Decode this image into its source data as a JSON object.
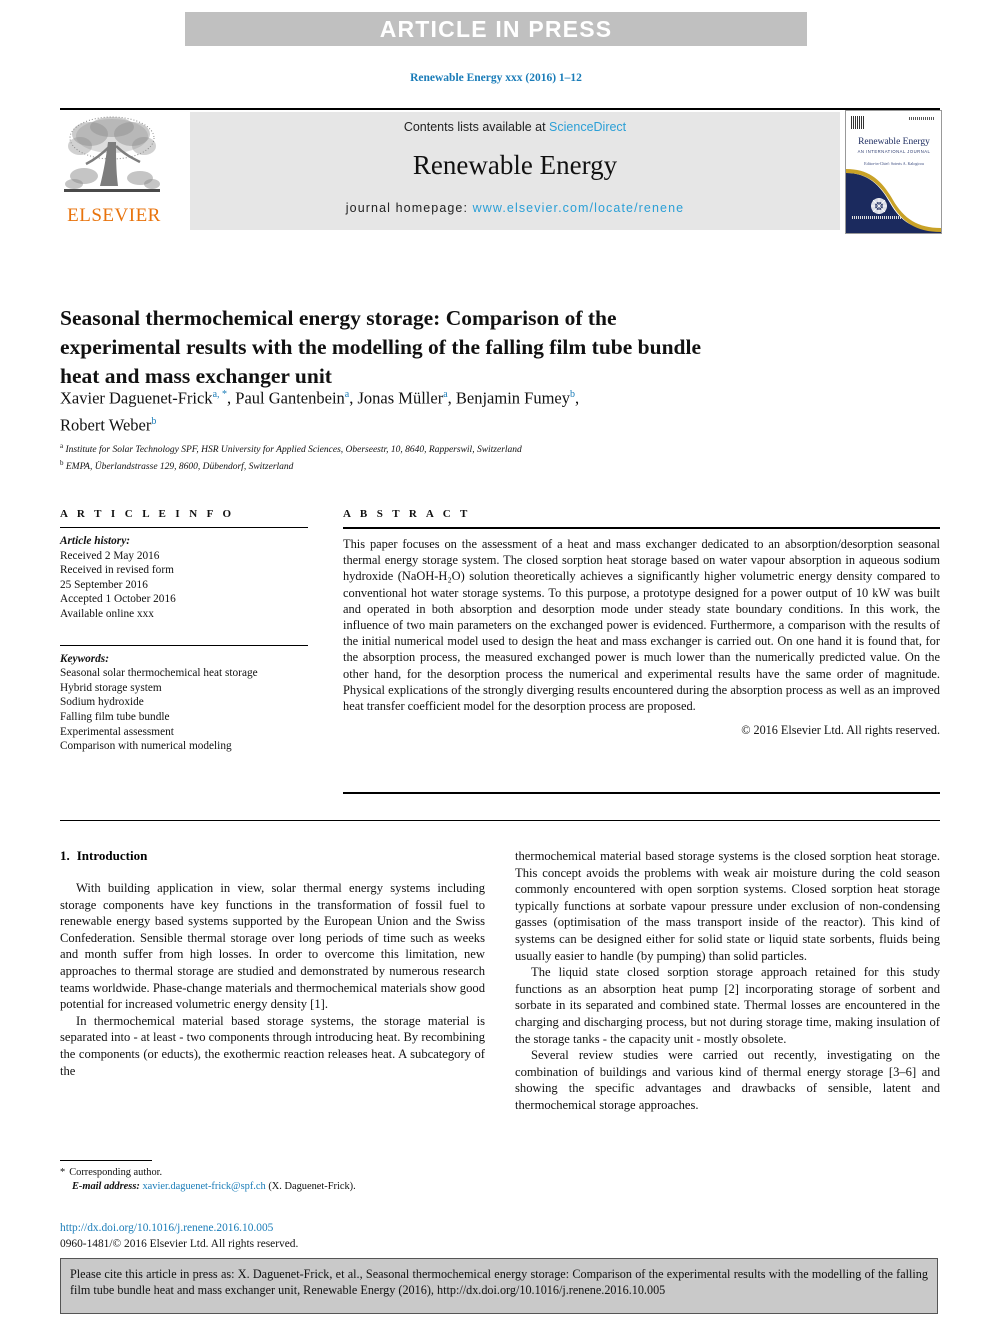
{
  "banner": {
    "label": "ARTICLE IN PRESS"
  },
  "journal_ref": "Renewable Energy xxx (2016) 1–12",
  "header": {
    "publisher": "ELSEVIER",
    "contents_prefix": "Contents lists available at ",
    "contents_link": "ScienceDirect",
    "journal_name": "Renewable Energy",
    "homepage_prefix": "journal homepage: ",
    "homepage_url": "www.elsevier.com/locate/renene",
    "cover": {
      "title": "Renewable Energy",
      "subtitle": "AN INTERNATIONAL JOURNAL",
      "subtitle2": "Editor-in-Chief: Soteris A. Kalogirou"
    }
  },
  "article": {
    "title": "Seasonal thermochemical energy storage: Comparison of the experimental results with the modelling of the falling film tube bundle heat and mass exchanger unit",
    "authors_line1": "Xavier Daguenet-Frick",
    "authors_sup1": "a, *",
    "authors_line1b": ", Paul Gantenbein",
    "authors_sup2": "a",
    "authors_line1c": ", Jonas Müller",
    "authors_sup3": "a",
    "authors_line1d": ", Benjamin Fumey",
    "authors_sup4": "b",
    "authors_line1e": ",",
    "authors_line2": "Robert Weber",
    "authors_sup5": "b",
    "affiliation_a_sup": "a",
    "affiliation_a": "Institute for Solar Technology SPF, HSR University for Applied Sciences, Oberseestr, 10, 8640, Rapperswil, Switzerland",
    "affiliation_b_sup": "b",
    "affiliation_b": "EMPA, Überlandstrasse 129, 8600, Dübendorf, Switzerland"
  },
  "article_info": {
    "heading": "A R T I C L E   I N F O",
    "history_label": "Article history:",
    "history": [
      "Received 2 May 2016",
      "Received in revised form",
      "25 September 2016",
      "Accepted 1 October 2016",
      "Available online xxx"
    ],
    "keywords_label": "Keywords:",
    "keywords": [
      "Seasonal solar thermochemical heat storage",
      "Hybrid storage system",
      "Sodium hydroxide",
      "Falling film tube bundle",
      "Experimental assessment",
      "Comparison with numerical modeling"
    ]
  },
  "abstract": {
    "heading": "A B S T R A C T",
    "text": "This paper focuses on the assessment of a heat and mass exchanger dedicated to an absorption/desorption seasonal thermal energy storage system. The closed sorption heat storage based on water vapour absorption in aqueous sodium hydroxide (NaOH-H₂O) solution theoretically achieves a significantly higher volumetric energy density compared to conventional hot water storage systems. To this purpose, a prototype designed for a power output of 10 kW was built and operated in both absorption and desorption mode under steady state boundary conditions. In this work, the influence of two main parameters on the exchanged power is evidenced. Furthermore, a comparison with the results of the initial numerical model used to design the heat and mass exchanger is carried out. On one hand it is found that, for the absorption process, the measured exchanged power is much lower than the numerically predicted value. On the other hand, for the desorption process the numerical and experimental results have the same order of magnitude. Physical explications of the strongly diverging results encountered during the absorption process as well as an improved heat transfer coefficient model for the desorption process are proposed.",
    "copyright": "© 2016 Elsevier Ltd. All rights reserved."
  },
  "body": {
    "section_number": "1.",
    "section_title": "Introduction",
    "left_paragraphs": [
      "With building application in view, solar thermal energy systems including storage components have key functions in the transformation of fossil fuel to renewable energy based systems supported by the European Union and the Swiss Confederation. Sensible thermal storage over long periods of time such as weeks and month suffer from high losses. In order to overcome this limitation, new approaches to thermal storage are studied and demonstrated by numerous research teams worldwide. Phase-change materials and thermochemical materials show good potential for increased volumetric energy density [1].",
      "In thermochemical material based storage systems, the storage material is separated into - at least - two components through introducing heat. By recombining the components (or educts), the exothermic reaction releases heat. A subcategory of the"
    ],
    "right_paragraphs": [
      "thermochemical material based storage systems is the closed sorption heat storage. This concept avoids the problems with weak air moisture during the cold season commonly encountered with open sorption systems. Closed sorption heat storage typically functions at sorbate vapour pressure under exclusion of non-condensing gasses (optimisation of the mass transport inside of the reactor). This kind of systems can be designed either for solid state or liquid state sorbents, fluids being usually easier to handle (by pumping) than solid particles.",
      "The liquid state closed sorption storage approach retained for this study functions as an absorption heat pump [2] incorporating storage of sorbent and sorbate in its separated and combined state. Thermal losses are encountered in the charging and discharging process, but not during storage time, making insulation of the storage tanks - the capacity unit - mostly obsolete.",
      "Several review studies were carried out recently, investigating on the combination of buildings and various kind of thermal energy storage [3–6] and showing the specific advantages and drawbacks of sensible, latent and thermochemical storage approaches."
    ]
  },
  "footnote": {
    "star": "*",
    "corresponding": "Corresponding author.",
    "email_label": "E-mail address:",
    "email": "xavier.daguenet-frick@spf.ch",
    "email_owner": "(X. Daguenet-Frick)."
  },
  "footer": {
    "doi": "http://dx.doi.org/10.1016/j.renene.2016.10.005",
    "issn": "0960-1481/© 2016 Elsevier Ltd. All rights reserved."
  },
  "cite_box": {
    "text": "Please cite this article in press as: X. Daguenet-Frick, et al., Seasonal thermochemical energy storage: Comparison of the experimental results with the modelling of the falling film tube bundle heat and mass exchanger unit, Renewable Energy (2016), http://dx.doi.org/10.1016/j.renene.2016.10.005"
  },
  "colors": {
    "link": "#1a7cb8",
    "sciencedirect": "#2b9fd6",
    "elsevier_orange": "#e8730c",
    "banner_bg": "#c0c0c0",
    "band_bg": "#e6e6e6",
    "cite_bg": "#c9c9c9",
    "cover_navy": "#1b2a5e"
  }
}
